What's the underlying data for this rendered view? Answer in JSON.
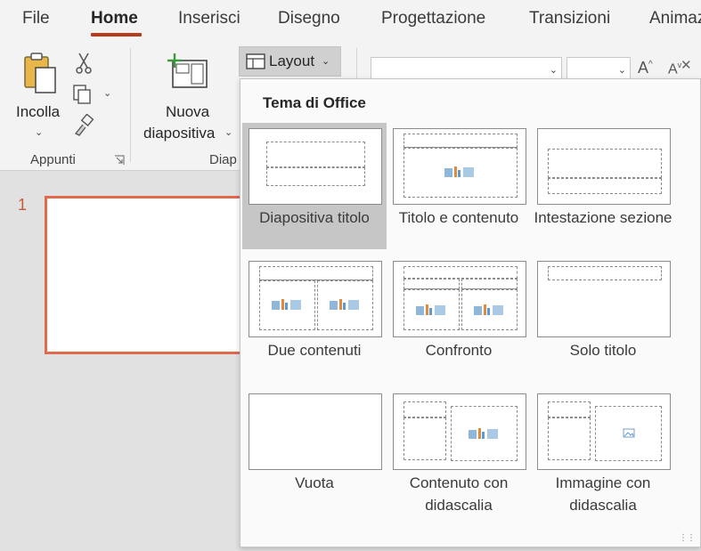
{
  "tabs": [
    "File",
    "Home",
    "Inserisci",
    "Disegno",
    "Progettazione",
    "Transizioni",
    "Animaz"
  ],
  "ribbon": {
    "paste_label": "Incolla",
    "clipboard_group": "Appunti",
    "new_slide_line1": "Nuova",
    "new_slide_line2": "diapositiva",
    "slides_group": "Diap",
    "layout_label": "Layout"
  },
  "slide_panel": {
    "slide_number": "1"
  },
  "layout_gallery": {
    "heading": "Tema di Office",
    "items": [
      {
        "label": "Diapositiva titolo",
        "selected": true
      },
      {
        "label": "Titolo e contenuto"
      },
      {
        "label": "Intestazione sezione"
      },
      {
        "label": "Due contenuti"
      },
      {
        "label": "Confronto"
      },
      {
        "label": "Solo titolo"
      },
      {
        "label": "Vuota"
      },
      {
        "label": "Contenuto con didascalia"
      },
      {
        "label": "Immagine con didascalia"
      }
    ]
  },
  "colors": {
    "accent": "#b83b1e",
    "slide_border": "#e3694d",
    "selected_bg": "#c6c6c6"
  }
}
